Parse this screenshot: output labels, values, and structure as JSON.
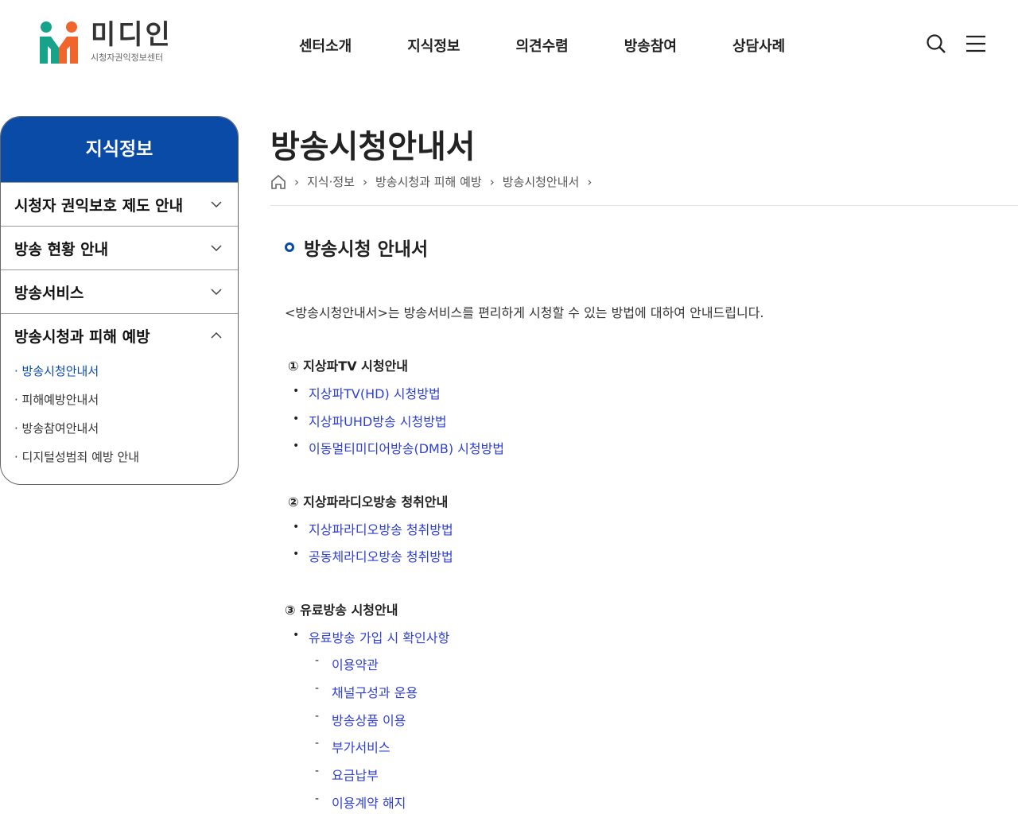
{
  "logo": {
    "name": "미디인",
    "subtitle": "시청자권익정보센터"
  },
  "gnb": [
    "센터소개",
    "지식정보",
    "의견수렴",
    "방송참여",
    "상담사례"
  ],
  "sidebar": {
    "title": "지식정보",
    "items": [
      "시청자 권익보호 제도 안내",
      "방송 현황 안내",
      "방송서비스",
      "방송시청과 피해 예방"
    ],
    "subs": [
      "· 방송시청안내서",
      "· 피해예방안내서",
      "· 방송참여안내서",
      "· 디지털성범죄 예방 안내"
    ]
  },
  "page": {
    "title": "방송시청안내서",
    "breadcrumb": [
      "지식·정보",
      "방송시청과 피해 예방",
      "방송시청안내서"
    ],
    "section": "방송시청 안내서",
    "intro": "<방송시청안내서>는 방송서비스를 편리하게 시청할 수 있는 방법에 대하여 안내드립니다."
  },
  "groups": [
    {
      "title": "① 지상파TV 시청안내",
      "links": [
        "지상파TV(HD) 시청방법",
        "지상파UHD방송 시청방법",
        "이동멀티미디어방송(DMB) 시청방법"
      ]
    },
    {
      "title": "② 지상파라디오방송 청취안내",
      "links": [
        "지상파라디오방송 청취방법",
        "공동체라디오방송 청취방법"
      ]
    },
    {
      "title": "③ 유료방송 시청안내",
      "links": [
        "유료방송 가입 시 확인사항"
      ],
      "sublinks": [
        "이용약관",
        "채널구성과 운용",
        "방송상품 이용",
        "부가서비스",
        "요금납부",
        "이용계약 해지"
      ]
    }
  ]
}
